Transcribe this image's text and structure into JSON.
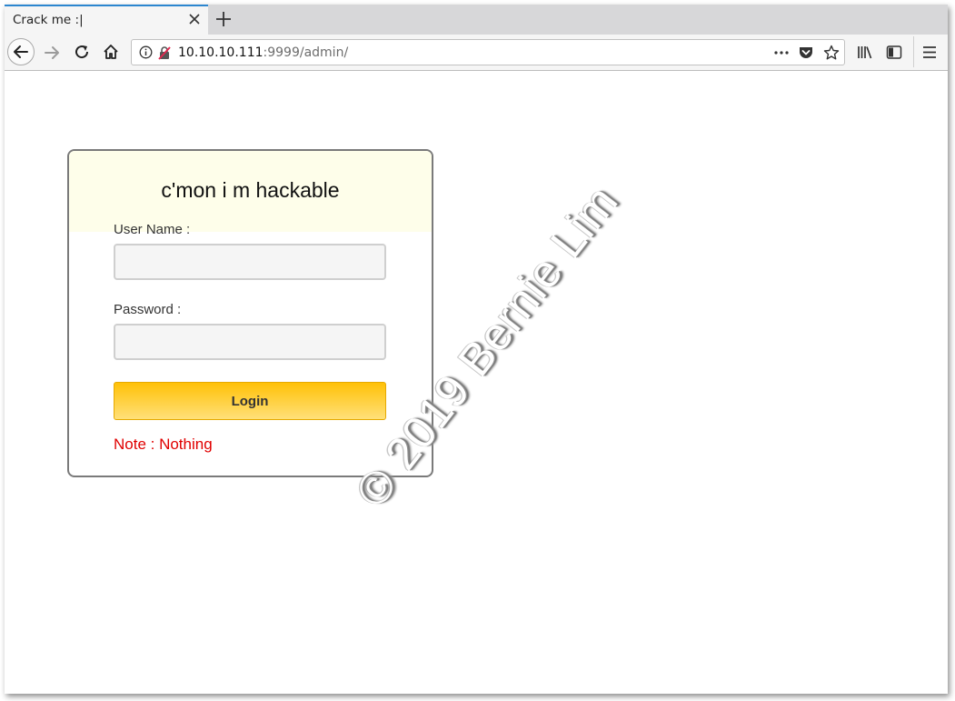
{
  "browser": {
    "tab_title": "Crack me :|",
    "url_host": "10.10.10.111",
    "url_rest": ":9999/admin/"
  },
  "icons": {
    "back": "back-arrow-icon",
    "forward": "forward-arrow-icon",
    "reload": "reload-icon",
    "home": "home-icon",
    "info": "info-icon",
    "insecure": "insecure-lock-icon",
    "page_actions": "ellipsis-icon",
    "pocket": "pocket-icon",
    "bookmark": "star-icon",
    "library": "library-icon",
    "sidebar": "sidebar-icon",
    "menu": "hamburger-menu-icon"
  },
  "login": {
    "title": "c'mon i m hackable",
    "username_label": "User Name :",
    "username_value": "",
    "password_label": "Password :",
    "password_value": "",
    "button_label": "Login",
    "note": "Note : Nothing"
  },
  "watermark": "© 2019 Bernie Lim",
  "colors": {
    "accent_tab": "#2c86cf",
    "button_top": "#ffc107",
    "note_red": "#e00000",
    "header_bg": "#fefeea"
  }
}
